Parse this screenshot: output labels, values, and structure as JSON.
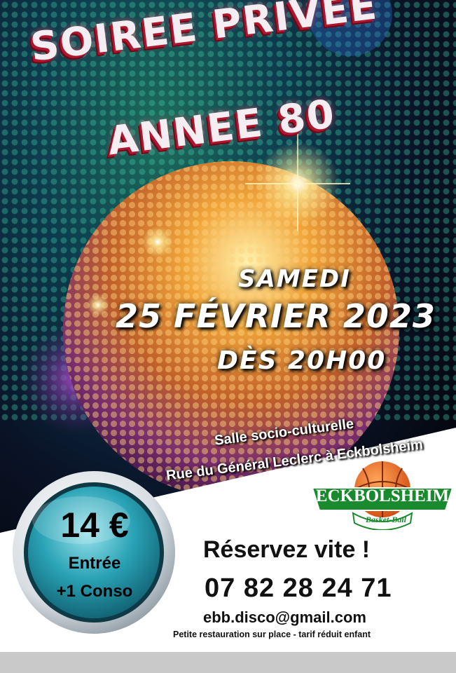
{
  "title": {
    "line1": "SOIREE PRIVEE",
    "line2": "ANNEE 80"
  },
  "date": {
    "day": "SAMEDI",
    "full": "25 FÉVRIER 2023",
    "time": "DÈS 20H00"
  },
  "venue": {
    "line1": "Salle socio-culturelle",
    "line2": "Rue du Général Leclerc  à Eckbolsheim"
  },
  "logo": {
    "name": "ECKBOLSHEIM",
    "sub": "Basket-Ball"
  },
  "badge": {
    "price": "14 €",
    "entree": "Entrée",
    "conso": "+1 Conso"
  },
  "contact": {
    "reserve": "Réservez vite !",
    "phone": "07 82 28 24 71",
    "email": "ebb.disco@gmail.com",
    "note": "Petite restauration sur place - tarif réduit enfant"
  },
  "colors": {
    "title_shadow": "#b0152e",
    "logo_green": "#1a8a2e",
    "badge_teal": "#2aa3b6",
    "ball_orange": "#e8601a"
  },
  "icons": [
    "disco-ball-icon",
    "basketball-icon"
  ]
}
